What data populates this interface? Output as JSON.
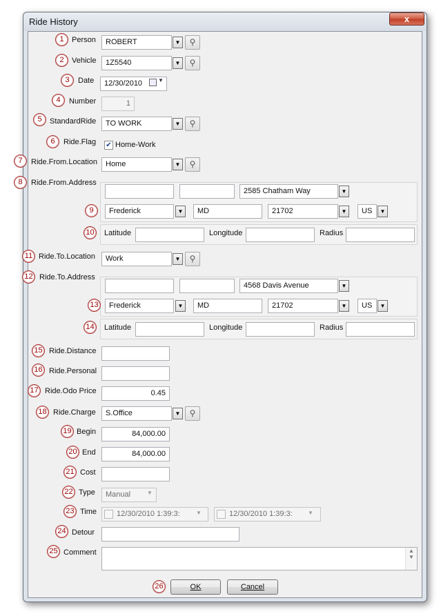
{
  "window": {
    "title": "Ride History",
    "close_label": "x"
  },
  "badges": [
    "1",
    "2",
    "3",
    "4",
    "5",
    "6",
    "7",
    "8",
    "9",
    "10",
    "11",
    "12",
    "13",
    "14",
    "15",
    "16",
    "17",
    "18",
    "19",
    "20",
    "21",
    "22",
    "23",
    "24",
    "25",
    "26"
  ],
  "labels": {
    "person": "Person",
    "vehicle": "Vehicle",
    "date": "Date",
    "number": "Number",
    "standard_ride": "StandardRide",
    "ride_flag": "Ride.Flag",
    "from_location": "Ride.From.Location",
    "from_address": "Ride.From.Address",
    "to_location": "Ride.To.Location",
    "to_address": "Ride.To.Address",
    "distance": "Ride.Distance",
    "personal": "Ride.Personal",
    "odo_price": "Ride.Odo Price",
    "charge": "Ride.Charge",
    "begin": "Begin",
    "end": "End",
    "cost": "Cost",
    "type": "Type",
    "time": "Time",
    "detour": "Detour",
    "comment": "Comment",
    "latitude": "Latitude",
    "longitude": "Longitude",
    "radius": "Radius"
  },
  "fields": {
    "person": "ROBERT",
    "vehicle": "1Z5540",
    "date": "12/30/2010",
    "number": "1",
    "standard_ride": "TO WORK",
    "ride_flag_label": "Home-Work",
    "ride_flag_checked": true,
    "from_location": "Home",
    "from_address": {
      "field1": "",
      "field2": "",
      "street": "2585 Chatham Way",
      "city": "Frederick",
      "state": "MD",
      "zip": "21702",
      "country": "US"
    },
    "from_geo": {
      "latitude": "",
      "longitude": "",
      "radius": ""
    },
    "to_location": "Work",
    "to_address": {
      "field1": "",
      "field2": "",
      "street": "4568 Davis Avenue",
      "city": "Frederick",
      "state": "MD",
      "zip": "21702",
      "country": "US"
    },
    "to_geo": {
      "latitude": "",
      "longitude": "",
      "radius": ""
    },
    "distance": "",
    "personal": "",
    "odo_price": "0.45",
    "charge": "S.Office",
    "begin": "84,000.00",
    "end": "84,000.00",
    "cost": "",
    "type": "Manual",
    "time_start": "12/30/2010   1:39:3:",
    "time_end": "12/30/2010   1:39:3:",
    "detour": "",
    "comment": ""
  },
  "buttons": {
    "ok": "OK",
    "cancel": "Cancel"
  },
  "icons": {
    "combo_arrow": "▼",
    "lookup": "search-icon",
    "calendar": "calendar-icon"
  }
}
